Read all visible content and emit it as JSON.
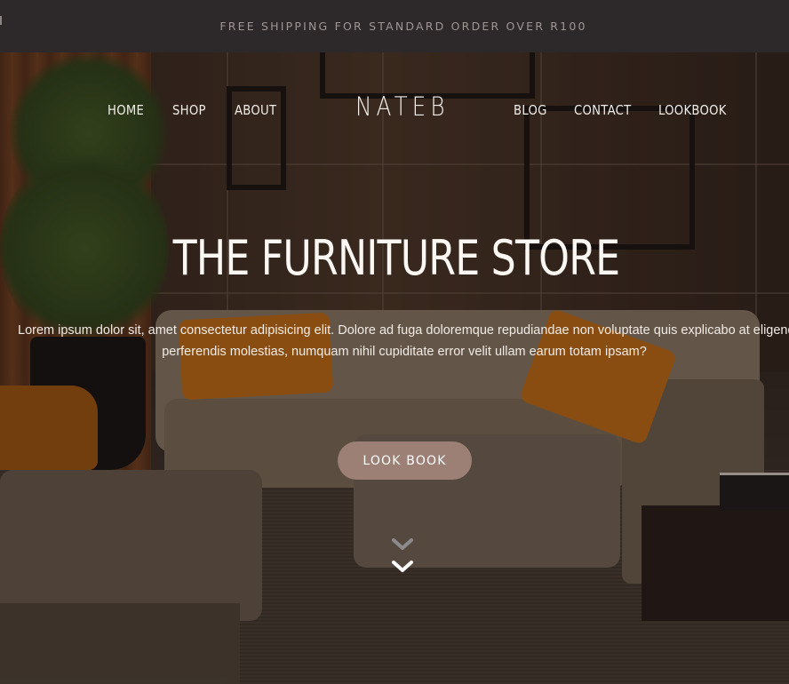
{
  "announcement": "FREE SHIPPING FOR STANDARD ORDER OVER R100",
  "nav": {
    "left": [
      "HOME",
      "SHOP",
      "ABOUT"
    ],
    "logo": "NATEB",
    "right": [
      "BLOG",
      "CONTACT",
      "LOOKBOOK"
    ]
  },
  "hero": {
    "title": "THE FURNITURE STORE",
    "description_line1": "Lorem ipsum dolor sit, amet consectetur adipisicing elit. Dolore ad fuga doloremque repudiandae non voluptate quis explicabo at eligendi",
    "description_line2": "perferendis molestias, numquam nihil cupiditate error velit ullam earum totam ipsam?",
    "button_label": "LOOK BOOK",
    "scroll_icon": "double-chevron-down-icon"
  },
  "colors": {
    "topbar_bg": "#2d2829",
    "button_bg": "#9c8076",
    "pillow": "#c56d14"
  }
}
